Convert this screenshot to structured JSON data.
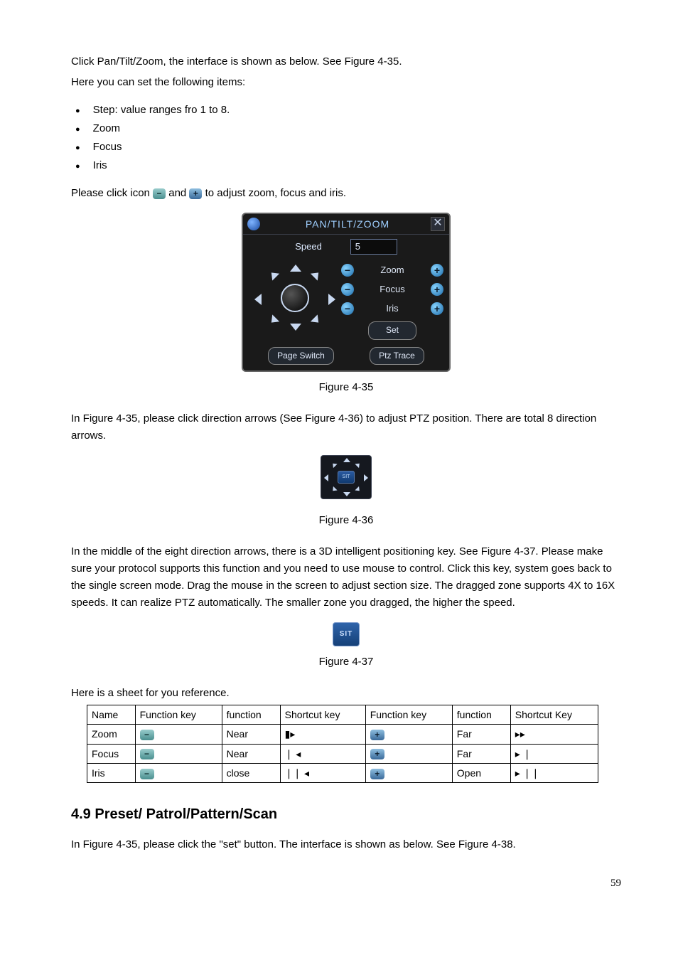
{
  "intro": {
    "p1": "Click Pan/Tilt/Zoom, the interface is shown as below. See Figure 4-35.",
    "p2": "Here you can set the following items:",
    "bullets": {
      "b1": "Step: value ranges fro 1 to 8.",
      "b2": "Zoom",
      "b3": "Focus",
      "b4": "Iris"
    },
    "p3a": "Please click icon ",
    "p3b": " and ",
    "p3c": " to adjust zoom, focus and iris."
  },
  "ptz": {
    "title": "PAN/TILT/ZOOM",
    "speed_label": "Speed",
    "speed_value": "5",
    "zoom": "Zoom",
    "focus": "Focus",
    "iris": "Iris",
    "set": "Set",
    "page_switch": "Page Switch",
    "ptz_trace": "Ptz Trace"
  },
  "captions": {
    "f35": "Figure 4-35",
    "f36": "Figure 4-36",
    "f37": "Figure 4-37"
  },
  "mid": {
    "p1": "In Figure 4-35, please click direction arrows (See Figure 4-36) to adjust PTZ position. There are total 8 direction arrows.",
    "p2": "In the middle of the eight direction arrows, there is a 3D intelligent positioning key. See Figure 4-37. Please make sure your protocol supports this function and you need to use mouse to control. Click this key, system goes back to the single screen mode. Drag the mouse in the screen to adjust section size.  The dragged zone supports 4X to 16X speeds. It can realize PTZ automatically. The smaller zone you dragged, the higher the speed.",
    "sit": "SIT",
    "sheet_intro": "Here is a sheet for you reference."
  },
  "table": {
    "h": {
      "name": "Name",
      "fk1": "Function key",
      "fn1": "function",
      "sk1": "Shortcut key",
      "fk2": "Function key",
      "fn2": "function",
      "sk2": "Shortcut Key"
    },
    "r1": {
      "name": "Zoom",
      "fn1": "Near",
      "sk1": "▮▸",
      "fn2": "Far",
      "sk2": "▸▸"
    },
    "r2": {
      "name": "Focus",
      "fn1": "Near",
      "sk1": "❘ ◂",
      "fn2": "Far",
      "sk2": "▸ ❘"
    },
    "r3": {
      "name": "Iris",
      "fn1": "close",
      "sk1": "❘❘ ◂",
      "fn2": "Open",
      "sk2": "▸ ❘❘"
    }
  },
  "section": {
    "title": "4.9  Preset/ Patrol/Pattern/Scan",
    "p1": "In  Figure 4-35, please click the \"set\" button. The interface is shown as below. See Figure 4-38."
  },
  "page_number": "59"
}
